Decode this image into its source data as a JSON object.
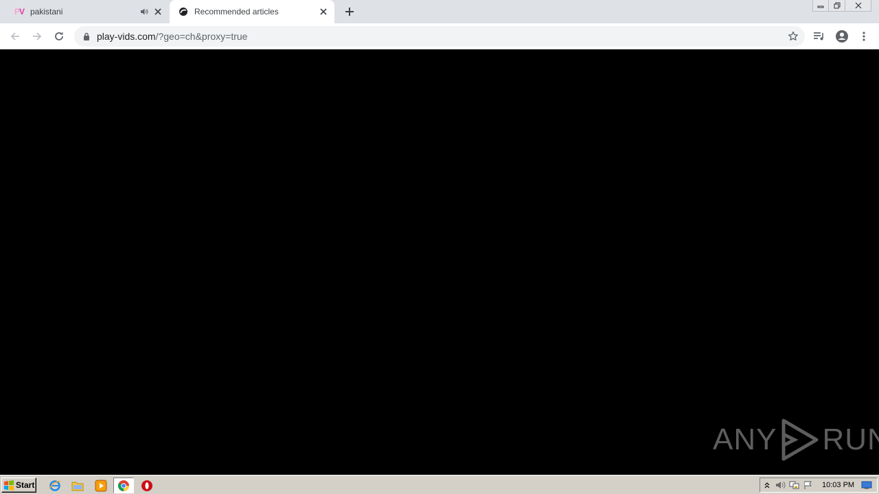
{
  "browser": {
    "tabs": [
      {
        "favicon_text": "PV",
        "title": "pakistani",
        "audio_playing": true
      },
      {
        "title": "Recommended articles",
        "active": true
      }
    ],
    "address_bar": {
      "host": "play-vids.com",
      "path": "/?geo=ch&proxy=true"
    }
  },
  "watermark": {
    "left_text": "ANY",
    "right_text": "RUN"
  },
  "taskbar": {
    "start_label": "Start",
    "clock": "10:03 PM"
  },
  "colors": {
    "tabstrip_bg": "#dee1e6",
    "page_bg": "#000000",
    "taskbar_bg": "#d4d0c8",
    "pv_pink": "#e040a0"
  }
}
